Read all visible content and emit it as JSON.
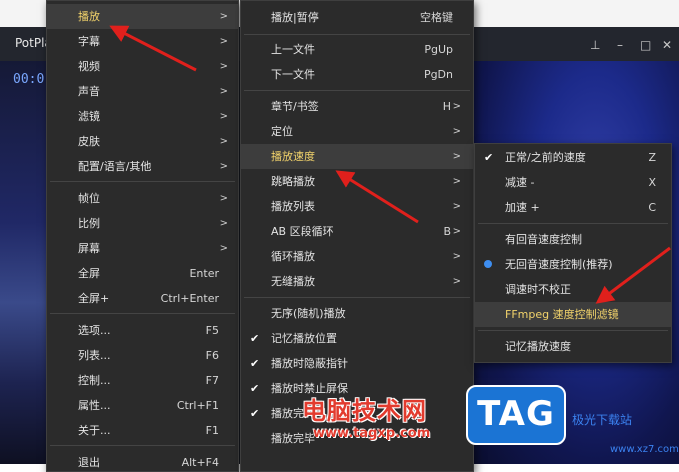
{
  "app": {
    "title": "PotPla",
    "timecode": "00:0"
  },
  "menu1": {
    "items": [
      {
        "label": "播放",
        "shortcut": "",
        "submenu": true,
        "highlighted": true
      },
      {
        "label": "字幕",
        "shortcut": "",
        "submenu": true
      },
      {
        "label": "视频",
        "shortcut": "",
        "submenu": true
      },
      {
        "label": "声音",
        "shortcut": "",
        "submenu": true
      },
      {
        "label": "滤镜",
        "shortcut": "",
        "submenu": true
      },
      {
        "label": "皮肤",
        "shortcut": "",
        "submenu": true
      },
      {
        "label": "配置/语言/其他",
        "shortcut": "",
        "submenu": true
      },
      {
        "label": "帧位",
        "shortcut": "",
        "submenu": true
      },
      {
        "label": "比例",
        "shortcut": "",
        "submenu": true
      },
      {
        "label": "屏幕",
        "shortcut": "",
        "submenu": true
      },
      {
        "label": "全屏",
        "shortcut": "Enter",
        "submenu": false
      },
      {
        "label": "全屏+",
        "shortcut": "Ctrl+Enter",
        "submenu": false
      },
      {
        "label": "选项...",
        "shortcut": "F5",
        "submenu": false
      },
      {
        "label": "列表...",
        "shortcut": "F6",
        "submenu": false
      },
      {
        "label": "控制...",
        "shortcut": "F7",
        "submenu": false
      },
      {
        "label": "属性...",
        "shortcut": "Ctrl+F1",
        "submenu": false
      },
      {
        "label": "关于...",
        "shortcut": "F1",
        "submenu": false
      },
      {
        "label": "退出",
        "shortcut": "Alt+F4",
        "submenu": false
      }
    ]
  },
  "menu2": {
    "items": [
      {
        "label": "播放|暂停",
        "shortcut": "空格键"
      },
      {
        "label": "上一文件",
        "shortcut": "PgUp"
      },
      {
        "label": "下一文件",
        "shortcut": "PgDn"
      },
      {
        "label": "章节/书签",
        "shortcut": "H"
      },
      {
        "label": "定位",
        "shortcut": ""
      },
      {
        "label": "播放速度",
        "shortcut": "",
        "highlighted": true
      },
      {
        "label": "跳略播放",
        "shortcut": ""
      },
      {
        "label": "播放列表",
        "shortcut": ""
      },
      {
        "label": "AB 区段循环",
        "shortcut": "B"
      },
      {
        "label": "循环播放",
        "shortcut": ""
      },
      {
        "label": "无缝播放",
        "shortcut": ""
      },
      {
        "label": "无序(随机)播放",
        "shortcut": ""
      },
      {
        "label": "记忆播放位置",
        "shortcut": "",
        "checked": true
      },
      {
        "label": "播放时隐蔽指针",
        "shortcut": "",
        "checked": true
      },
      {
        "label": "播放时禁止屏保",
        "shortcut": "",
        "checked": true
      },
      {
        "label": "播放完关闭",
        "shortcut": "",
        "checked": true
      },
      {
        "label": "播放完毕",
        "shortcut": ""
      }
    ]
  },
  "menu3": {
    "items": [
      {
        "label": "正常/之前的速度",
        "shortcut": "Z",
        "checked": true
      },
      {
        "label": "减速 -",
        "shortcut": "X"
      },
      {
        "label": "加速 +",
        "shortcut": "C"
      },
      {
        "label": "有回音速度控制",
        "shortcut": ""
      },
      {
        "label": "无回音速度控制(推荐)",
        "shortcut": "",
        "selected": true
      },
      {
        "label": "调速时不校正",
        "shortcut": ""
      },
      {
        "label": "FFmpeg 速度控制滤镜",
        "shortcut": "",
        "highlighted": true
      },
      {
        "label": "记忆播放速度",
        "shortcut": ""
      }
    ]
  },
  "watermark": {
    "text": "电脑技术网",
    "url": "www.tagxp.com",
    "logo": "TAG",
    "site": "极光下载站",
    "site2": "www.xz7.com"
  },
  "icons": {
    "arrow": "submenu-arrow-icon",
    "check": "check-icon",
    "radio": "radio-dot-icon",
    "annotation": "red-arrow-icon"
  },
  "colors": {
    "menu_bg": "#2b2b2b",
    "highlight_text": "#f2d36b",
    "annotation": "#e0201c",
    "radio": "#3e8ef0"
  }
}
